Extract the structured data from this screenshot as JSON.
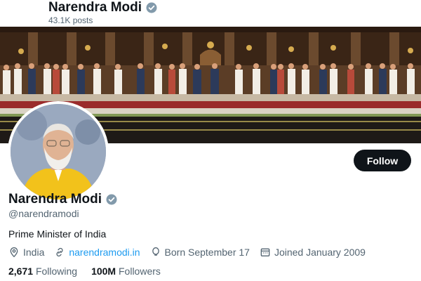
{
  "header": {
    "name": "Narendra Modi",
    "posts_count": "43.1K posts"
  },
  "banner": {
    "alt": "Group photo of ministers at Rashtrapati Bhavan"
  },
  "profile": {
    "name": "Narendra Modi",
    "handle": "@narendramodi",
    "bio": "Prime Minister of India",
    "follow_label": "Follow",
    "verified_icon": "verified-badge-icon",
    "accent_color": "#1d9bf0"
  },
  "meta": {
    "location": "India",
    "website": "narendramodi.in",
    "birthday": "Born September 17",
    "joined": "Joined January 2009"
  },
  "stats": {
    "following_count": "2,671",
    "following_label": "Following",
    "followers_count": "100M",
    "followers_label": "Followers"
  }
}
